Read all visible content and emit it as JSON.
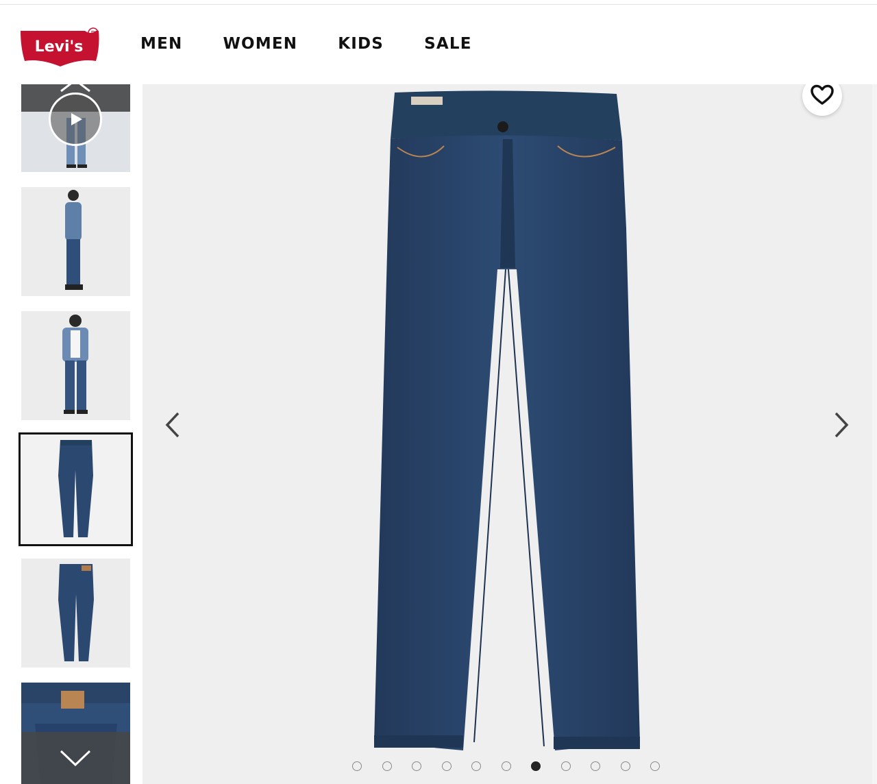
{
  "brand": {
    "logo_text": "Levi's",
    "registered_mark": "R",
    "color": "#c41230"
  },
  "nav": {
    "items": [
      "MEN",
      "WOMEN",
      "KIDS",
      "SALE"
    ]
  },
  "gallery": {
    "thumbnail_count": 6,
    "selected_thumbnail": 4,
    "carousel_dot_count": 11,
    "active_dot": 7,
    "jeans_color": "#2b4870"
  },
  "icons": {
    "favorite": "heart-icon",
    "prev": "chevron-left-icon",
    "next": "chevron-right-icon",
    "thumb_up": "chevron-up-icon",
    "thumb_down": "chevron-down-icon",
    "play": "play-icon"
  }
}
